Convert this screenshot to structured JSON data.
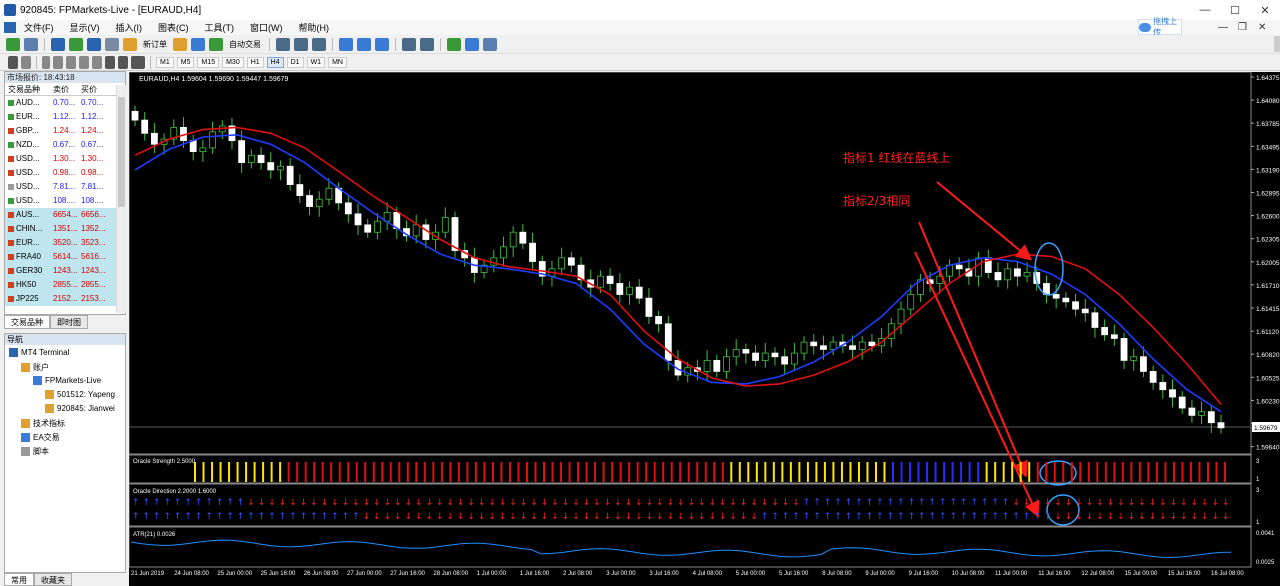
{
  "window": {
    "title": "920845: FPMarkets-Live - [EURAUD,H4]"
  },
  "menu": {
    "items": [
      "文件(F)",
      "显示(V)",
      "插入(I)",
      "图表(C)",
      "工具(T)",
      "窗口(W)",
      "帮助(H)"
    ]
  },
  "upload_button": "拖拽上传",
  "toolbar": {
    "new_order": "新订单",
    "auto_trading": "自动交易",
    "timeframes": [
      "M1",
      "M5",
      "M15",
      "M30",
      "H1",
      "H4",
      "D1",
      "W1",
      "MN"
    ],
    "active_timeframe": "H4"
  },
  "market_watch": {
    "title": "市场报价: 18:43:18",
    "col_symbol": "交易品种",
    "col_bid": "卖价",
    "col_ask": "买价",
    "rows": [
      {
        "symbol": "AUD...",
        "bid": "0.70...",
        "ask": "0.70...",
        "color": "#1a1aff",
        "icon": "#3a9a3a",
        "cfd": false
      },
      {
        "symbol": "EUR...",
        "bid": "1.12...",
        "ask": "1.12...",
        "color": "#1a1aff",
        "icon": "#3a9a3a",
        "cfd": false
      },
      {
        "symbol": "GBP...",
        "bid": "1.24...",
        "ask": "1.24...",
        "color": "#d40000",
        "icon": "#d04020",
        "cfd": false
      },
      {
        "symbol": "NZD...",
        "bid": "0.67...",
        "ask": "0.67...",
        "color": "#1a1aff",
        "icon": "#3a9a3a",
        "cfd": false
      },
      {
        "symbol": "USD...",
        "bid": "1.30...",
        "ask": "1.30...",
        "color": "#d40000",
        "icon": "#d04020",
        "cfd": false
      },
      {
        "symbol": "USD...",
        "bid": "0.98...",
        "ask": "0.98...",
        "color": "#d40000",
        "icon": "#d04020",
        "cfd": false
      },
      {
        "symbol": "USD...",
        "bid": "7.81...",
        "ask": "7.81...",
        "color": "#1a1aff",
        "icon": "#9a9a9a",
        "cfd": false
      },
      {
        "symbol": "USD...",
        "bid": "108....",
        "ask": "108....",
        "color": "#1a1aff",
        "icon": "#3a9a3a",
        "cfd": false
      },
      {
        "symbol": "AUS...",
        "bid": "6654...",
        "ask": "6656...",
        "color": "#d40000",
        "icon": "#d04020",
        "cfd": true
      },
      {
        "symbol": "CHIN...",
        "bid": "1351...",
        "ask": "1352...",
        "color": "#d40000",
        "icon": "#d04020",
        "cfd": true
      },
      {
        "symbol": "EUR...",
        "bid": "3520...",
        "ask": "3523...",
        "color": "#d40000",
        "icon": "#d04020",
        "cfd": true
      },
      {
        "symbol": "FRA40",
        "bid": "5614...",
        "ask": "5616...",
        "color": "#d40000",
        "icon": "#d04020",
        "cfd": true
      },
      {
        "symbol": "GER30",
        "bid": "1243...",
        "ask": "1243...",
        "color": "#d40000",
        "icon": "#d04020",
        "cfd": true
      },
      {
        "symbol": "HK50",
        "bid": "2855...",
        "ask": "2855...",
        "color": "#d40000",
        "icon": "#d04020",
        "cfd": true
      },
      {
        "symbol": "JP225",
        "bid": "2152...",
        "ask": "2153...",
        "color": "#d40000",
        "icon": "#d04020",
        "cfd": true
      }
    ],
    "tabs": [
      "交易品种",
      "即时图"
    ]
  },
  "navigator": {
    "title": "导航",
    "items": [
      {
        "label": "MT4 Terminal",
        "level": 0,
        "icon": "#2a64b0"
      },
      {
        "label": "账户",
        "level": 1,
        "icon": "#e0a030"
      },
      {
        "label": "FPMarkets-Live",
        "level": 2,
        "icon": "#3a7bd5"
      },
      {
        "label": "501512: Yapeng",
        "level": 3,
        "icon": "#e0a030"
      },
      {
        "label": "920845: Jianwei",
        "level": 3,
        "icon": "#e0a030"
      },
      {
        "label": "技术指标",
        "level": 1,
        "icon": "#e0a030"
      },
      {
        "label": "EA交易",
        "level": 1,
        "icon": "#3a7bd5"
      },
      {
        "label": "脚本",
        "level": 1,
        "icon": "#9a9a9a"
      }
    ],
    "tabs": [
      "常用",
      "收藏夹"
    ]
  },
  "chart": {
    "header": "EURAUD,H4  1.59604 1.59690 1.59447 1.59679",
    "price_labels": [
      "1.64375",
      "1.64080",
      "1.63785",
      "1.63495",
      "1.63190",
      "1.62895",
      "1.62600",
      "1.62305",
      "1.62005",
      "1.61710",
      "1.61415",
      "1.61120",
      "1.60820",
      "1.60525",
      "1.60230",
      "1.59935",
      "1.59640"
    ],
    "current_price": "1.59679",
    "date_labels": [
      "21 Jun 2019",
      "24 Jun 08:00",
      "25 Jun 00:00",
      "25 Jun 16:00",
      "26 Jun 08:00",
      "27 Jun 00:00",
      "27 Jun 16:00",
      "28 Jun 08:00",
      "1 Jul 00:00",
      "1 Jul 16:00",
      "2 Jul 08:00",
      "3 Jul 00:00",
      "3 Jul 16:00",
      "4 Jul 08:00",
      "5 Jul 00:00",
      "5 Jul 16:00",
      "8 Jul 08:00",
      "9 Jul 00:00",
      "9 Jul 16:00",
      "10 Jul 08:00",
      "11 Jul 00:00",
      "11 Jul 16:00",
      "12 Jul 08:00",
      "15 Jul 00:00",
      "15 Jul 16:00",
      "16 Jul 08:00"
    ],
    "annotation1": "指标1 红线在蓝线上",
    "annotation2": "指标2/3相同",
    "oracle_strength_label": "Oracle Strength 2.5000",
    "oracle_strength_axis": [
      "3",
      "1"
    ],
    "oracle_direction_label": "Oracle Direction 2.2000 1.6000",
    "oracle_direction_axis": [
      "3",
      "1"
    ],
    "atr_label": "ATR(21) 0.0026",
    "atr_axis": [
      "0.0041",
      "0.0025"
    ]
  },
  "chart_data": {
    "type": "candlestick",
    "symbol": "EURAUD",
    "timeframe": "H4",
    "ylim": [
      1.5935,
      1.644
    ],
    "closes": [
      1.6388,
      1.637,
      1.6355,
      1.6362,
      1.6378,
      1.636,
      1.6345,
      1.635,
      1.6372,
      1.638,
      1.636,
      1.633,
      1.634,
      1.633,
      1.632,
      1.6325,
      1.63,
      1.6285,
      1.627,
      1.628,
      1.6295,
      1.6275,
      1.626,
      1.6245,
      1.6235,
      1.625,
      1.6262,
      1.624,
      1.623,
      1.6245,
      1.6225,
      1.6235,
      1.6255,
      1.621,
      1.62,
      1.618,
      1.619,
      1.62,
      1.6215,
      1.6235,
      1.622,
      1.6195,
      1.6175,
      1.6185,
      1.62,
      1.619,
      1.617,
      1.616,
      1.6175,
      1.6165,
      1.615,
      1.616,
      1.6145,
      1.612,
      1.611,
      1.606,
      1.604,
      1.605,
      1.6045,
      1.606,
      1.6045,
      1.6065,
      1.6075,
      1.607,
      1.606,
      1.607,
      1.6065,
      1.6055,
      1.607,
      1.6085,
      1.608,
      1.6075,
      1.6085,
      1.608,
      1.6075,
      1.6085,
      1.608,
      1.609,
      1.611,
      1.613,
      1.615,
      1.617,
      1.6165,
      1.6175,
      1.619,
      1.6185,
      1.6175,
      1.62,
      1.618,
      1.617,
      1.6185,
      1.6175,
      1.618,
      1.6165,
      1.615,
      1.6145,
      1.614,
      1.613,
      1.6125,
      1.6105,
      1.6095,
      1.609,
      1.606,
      1.6065,
      1.6045,
      1.603,
      1.602,
      1.601,
      1.5995,
      1.5985,
      1.599,
      1.5975,
      1.5968
    ],
    "ma_red": [
      1.634,
      1.6362,
      1.6375,
      1.6378,
      1.637,
      1.635,
      1.6318,
      1.6285,
      1.6255,
      1.6225,
      1.62,
      1.6188,
      1.6182,
      1.6175,
      1.615,
      1.61,
      1.6062,
      1.6036,
      1.6025,
      1.6028,
      1.604,
      1.6058,
      1.6085,
      1.6125,
      1.6165,
      1.6195,
      1.6205,
      1.6202,
      1.6185,
      1.615,
      1.6105,
      1.6055,
      1.6
    ],
    "ma_blue": [
      1.632,
      1.6348,
      1.6365,
      1.6368,
      1.6355,
      1.633,
      1.6295,
      1.6262,
      1.6232,
      1.6205,
      1.619,
      1.6185,
      1.6178,
      1.6165,
      1.613,
      1.6082,
      1.6048,
      1.603,
      1.6028,
      1.6038,
      1.6058,
      1.6085,
      1.612,
      1.6165,
      1.619,
      1.62,
      1.6195,
      1.6178,
      1.615,
      1.611,
      1.6062,
      1.602,
      1.599
    ],
    "strength_colors": [
      "yellow",
      "yellow",
      "yellow",
      "yellow",
      "yellow",
      "yellow",
      "yellow",
      "yellow",
      "yellow",
      "yellow",
      "yellow",
      "red",
      "red",
      "red",
      "red",
      "red",
      "red",
      "red",
      "red",
      "red",
      "red",
      "red",
      "red",
      "red",
      "red",
      "red",
      "red",
      "red",
      "red",
      "red",
      "red",
      "red",
      "red",
      "red",
      "red",
      "red",
      "red",
      "red",
      "red",
      "red",
      "red",
      "red",
      "red",
      "red",
      "red",
      "red",
      "red",
      "red",
      "red",
      "red",
      "red",
      "red",
      "red",
      "red",
      "red",
      "red",
      "red",
      "red",
      "red",
      "red",
      "red",
      "red",
      "red",
      "yellow",
      "yellow",
      "yellow",
      "yellow",
      "yellow",
      "yellow",
      "yellow",
      "yellow",
      "yellow",
      "yellow",
      "yellow",
      "yellow",
      "yellow",
      "yellow",
      "yellow",
      "yellow",
      "yellow",
      "yellow",
      "yellow",
      "blue",
      "blue",
      "blue",
      "blue",
      "blue",
      "blue",
      "blue",
      "blue",
      "blue",
      "blue",
      "blue",
      "yellow",
      "yellow",
      "yellow",
      "yellow",
      "yellow",
      "yellow",
      "red",
      "red",
      "red",
      "red",
      "red",
      "red",
      "red",
      "red",
      "red",
      "red",
      "red",
      "red",
      "red",
      "red",
      "red",
      "red",
      "red",
      "red",
      "red",
      "red",
      "red",
      "red",
      "red"
    ]
  }
}
